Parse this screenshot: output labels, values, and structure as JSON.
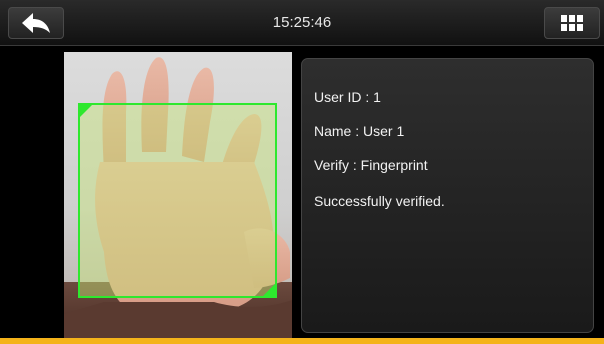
{
  "header": {
    "time": "15:25:46",
    "back_icon": "back-arrow-icon",
    "menu_icon": "grid-menu-icon"
  },
  "verification": {
    "user_id": "User ID : 1",
    "name": "Name : User 1",
    "verify": "Verify : Fingerprint",
    "status": "Successfully verified."
  },
  "colors": {
    "detection_box": "#2ee82e",
    "accent_bar": "#f4b31a",
    "text": "#f2f2f2"
  }
}
